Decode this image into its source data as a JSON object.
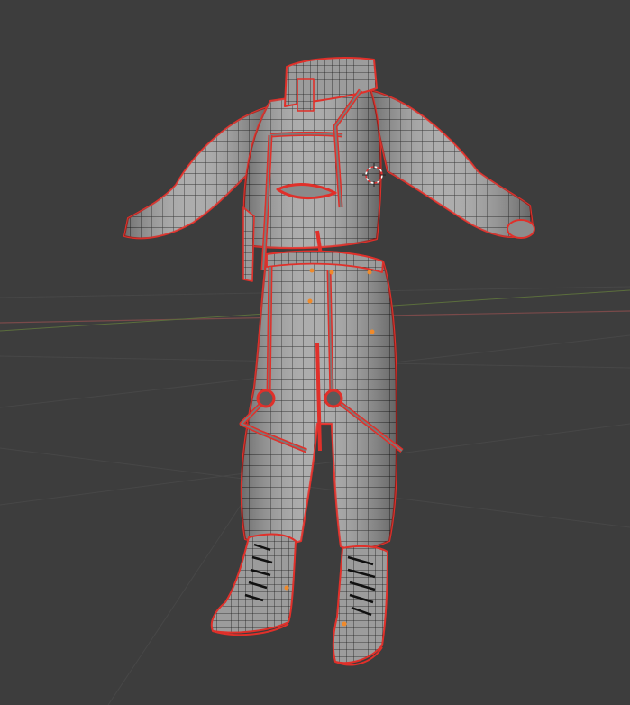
{
  "viewport": {
    "background": "#3d3d3d",
    "grid_color": "#4a4a4a",
    "x_axis_color": "#7a4a4a",
    "y_axis_color": "#5b6e3d"
  },
  "model": {
    "mesh_fill": "#a9a9a9",
    "wire_color": "#1a1a1a",
    "selection_outline": "#e0302a",
    "vertex_marker": "#f08a2a",
    "parts": [
      "jacket",
      "harness-straps",
      "trousers",
      "suspenders",
      "left-boot",
      "right-boot"
    ]
  },
  "cursor": {
    "icon": "3d-cursor-icon",
    "color_a": "#e03030",
    "color_b": "#ffffff"
  }
}
